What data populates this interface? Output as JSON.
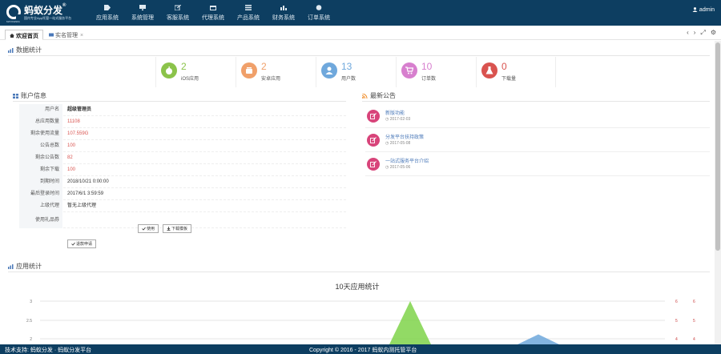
{
  "brand": {
    "title": "蚂蚁分发",
    "subtitle": "国内专业App托管一站式服务平台",
    "small": "MAYIFENFA"
  },
  "nav": [
    {
      "label": "应用系统",
      "icon": "tag-icon"
    },
    {
      "label": "系统管理",
      "icon": "monitor-icon"
    },
    {
      "label": "客服系统",
      "icon": "edit-icon"
    },
    {
      "label": "代理系统",
      "icon": "calendar-icon"
    },
    {
      "label": "产品系统",
      "icon": "list-icon"
    },
    {
      "label": "财务系统",
      "icon": "chart-icon"
    },
    {
      "label": "订单系统",
      "icon": "globe-icon"
    }
  ],
  "user": {
    "name": "admin"
  },
  "tabs": [
    {
      "label": "欢迎首页"
    },
    {
      "label": "实名管理"
    }
  ],
  "sections": {
    "data_stats": "数据统计",
    "account_info": "账户信息",
    "latest_news": "最新公告",
    "app_stats": "应用统计"
  },
  "stats": [
    {
      "value": "2",
      "label": "iOS应用",
      "color": "#8bc34a",
      "icon": "apple-icon"
    },
    {
      "value": "2",
      "label": "安卓应用",
      "color": "#f0a06a",
      "icon": "android-icon"
    },
    {
      "value": "13",
      "label": "用户数",
      "color": "#6fa8dc",
      "icon": "user-icon"
    },
    {
      "value": "10",
      "label": "订单数",
      "color": "#d77fce",
      "icon": "cart-icon"
    },
    {
      "value": "0",
      "label": "下载量",
      "color": "#d9534f",
      "icon": "flask-icon"
    }
  ],
  "account": [
    {
      "key": "用户名",
      "value": "超级管理员",
      "style": "bold"
    },
    {
      "key": "总应用数量",
      "value": "11108",
      "style": "red"
    },
    {
      "key": "剩余使用流量",
      "value": "107.559G",
      "style": "red"
    },
    {
      "key": "公告总数",
      "value": "100",
      "style": "red"
    },
    {
      "key": "剩余公告数",
      "value": "82",
      "style": "red"
    },
    {
      "key": "剩余下载",
      "value": "100",
      "style": "red"
    },
    {
      "key": "到期时间",
      "value": "2018/10/21 0:00:00",
      "style": ""
    },
    {
      "key": "最后登录时间",
      "value": "2017/6/1 3:59:59",
      "style": ""
    },
    {
      "key": "上级代理",
      "value": "暂无上级代理",
      "style": ""
    },
    {
      "key": "使用礼品券",
      "value": "",
      "style": ""
    }
  ],
  "buttons": {
    "use": "使用",
    "download": "下载模板",
    "cash": "退款申请"
  },
  "news": [
    {
      "title": "新版功能",
      "date": "2017-02-03"
    },
    {
      "title": "分发平台扶持政策",
      "date": "2017-05-08"
    },
    {
      "title": "一站式服务平台介绍",
      "date": "2017-05-06"
    }
  ],
  "chart_data": {
    "type": "line",
    "title": "10天应用统计",
    "yticks_left": [
      "3",
      "2.5",
      "2"
    ],
    "yticks_right_a": [
      "6",
      "5",
      "4"
    ],
    "yticks_right_b": [
      "6",
      "5",
      "4"
    ],
    "series": [
      {
        "color": "#7fd34a",
        "peak_x_index": 5,
        "peak_value": 3
      },
      {
        "color": "#6fa8dc",
        "peak_x_index": 7,
        "peak_value": 2
      }
    ]
  },
  "footer": {
    "support": "技术支持: 蚂蚁分发 · 蚂蚁分发平台",
    "copyright": "Copyright © 2016 - 2017 蚂蚁内测托管平台"
  }
}
